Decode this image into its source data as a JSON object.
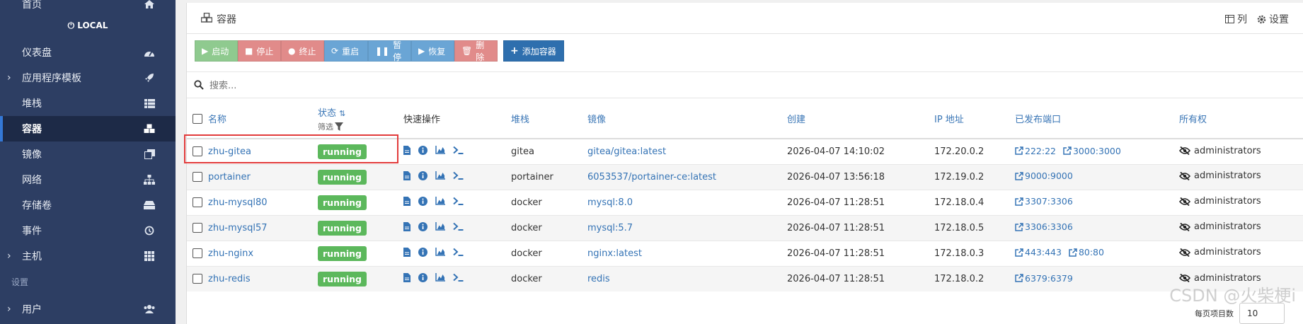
{
  "sidebar": {
    "top_item": "首页",
    "endpoint": "LOCAL",
    "items": [
      {
        "label": "仪表盘",
        "icon": "dashboard-icon"
      },
      {
        "label": "应用程序模板",
        "icon": "rocket-icon",
        "expandable": true
      },
      {
        "label": "堆栈",
        "icon": "list-icon"
      },
      {
        "label": "容器",
        "icon": "cubes-icon",
        "active": true
      },
      {
        "label": "镜像",
        "icon": "clone-icon"
      },
      {
        "label": "网络",
        "icon": "sitemap-icon"
      },
      {
        "label": "存储卷",
        "icon": "hdd-icon"
      },
      {
        "label": "事件",
        "icon": "history-icon"
      },
      {
        "label": "主机",
        "icon": "grid-icon",
        "expandable": true
      }
    ],
    "section_settings": "设置",
    "settings_items": [
      {
        "label": "用户",
        "icon": "users-icon",
        "expandable": true
      }
    ]
  },
  "panel": {
    "title": "容器",
    "tools": {
      "columns": "列",
      "settings": "设置"
    }
  },
  "actions": {
    "start": "启动",
    "stop": "停止",
    "kill": "终止",
    "restart": "重启",
    "pause": "暂停",
    "resume": "恢复",
    "remove": "删除",
    "add": "添加容器"
  },
  "search": {
    "placeholder": "搜索..."
  },
  "table": {
    "headers": {
      "name": "名称",
      "state": "状态",
      "filter": "筛选",
      "quick_actions": "快速操作",
      "stack": "堆栈",
      "image": "镜像",
      "created": "创建",
      "ip": "IP 地址",
      "ports": "已发布端口",
      "ownership": "所有权"
    },
    "rows": [
      {
        "name": "zhu-gitea",
        "state": "running",
        "stack": "gitea",
        "image": "gitea/gitea:latest",
        "created": "2026-04-07 14:10:02",
        "ip": "172.20.0.2",
        "ports": [
          "222:22",
          "3000:3000"
        ],
        "owner": "administrators"
      },
      {
        "name": "portainer",
        "state": "running",
        "stack": "portainer",
        "image": "6053537/portainer-ce:latest",
        "created": "2026-04-07 13:56:18",
        "ip": "172.19.0.2",
        "ports": [
          "9000:9000"
        ],
        "owner": "administrators"
      },
      {
        "name": "zhu-mysql80",
        "state": "running",
        "stack": "docker",
        "image": "mysql:8.0",
        "created": "2026-04-07 11:28:51",
        "ip": "172.18.0.4",
        "ports": [
          "3307:3306"
        ],
        "owner": "administrators"
      },
      {
        "name": "zhu-mysql57",
        "state": "running",
        "stack": "docker",
        "image": "mysql:5.7",
        "created": "2026-04-07 11:28:51",
        "ip": "172.18.0.5",
        "ports": [
          "3306:3306"
        ],
        "owner": "administrators"
      },
      {
        "name": "zhu-nginx",
        "state": "running",
        "stack": "docker",
        "image": "nginx:latest",
        "created": "2026-04-07 11:28:51",
        "ip": "172.18.0.3",
        "ports": [
          "443:443",
          "80:80"
        ],
        "owner": "administrators"
      },
      {
        "name": "zhu-redis",
        "state": "running",
        "stack": "docker",
        "image": "redis",
        "created": "2026-04-07 11:28:51",
        "ip": "172.18.0.2",
        "ports": [
          "6379:6379"
        ],
        "owner": "administrators"
      }
    ]
  },
  "pager": {
    "label": "每页项目数",
    "value": "10"
  },
  "watermark": "CSDN @火柴梗i",
  "colors": {
    "sidebar": "#2d3e63",
    "running": "#5cb85c",
    "link": "#3473b5",
    "highlight": "#e23b3b"
  }
}
